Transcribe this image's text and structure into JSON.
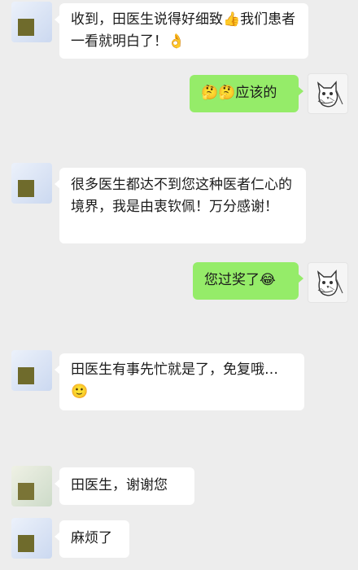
{
  "messages": [
    {
      "side": "in",
      "text": "收到，田医生说得好细致👍我们患者一看就明白了！👌"
    },
    {
      "side": "out",
      "text": "🤔🤔应该的"
    },
    {
      "side": "in",
      "text": "很多医生都达不到您这种医者仁心的境界，我是由衷钦佩！万分感谢！"
    },
    {
      "side": "out",
      "text": "您过奖了😂"
    },
    {
      "side": "in",
      "text": "田医生有事先忙就是了，免复哦…🙂"
    },
    {
      "side": "in",
      "text": "田医生，谢谢您"
    },
    {
      "side": "in",
      "text": "麻烦了"
    }
  ],
  "avatars": {
    "patient": "blurred-avatar",
    "doctor": "cat-sketch-avatar"
  },
  "colors": {
    "background": "#ededed",
    "incoming_bubble": "#ffffff",
    "outgoing_bubble": "#95ec69"
  }
}
